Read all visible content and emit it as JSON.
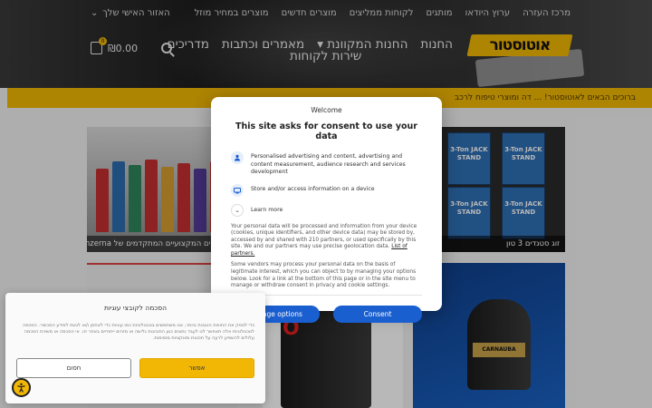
{
  "header": {
    "top_nav": [
      "מרכז העזרה",
      "ערוץ היודאו",
      "מותגים",
      "לקוחות ממליצים",
      "מוצרים חדשים",
      "מוצרים במחיר מוזל"
    ],
    "region_label": "האזור האישי שלך",
    "logo_text": "אוטוסטור",
    "main_nav": [
      "החנות",
      "החנות המקוונת",
      "מאמרים וכתבות",
      "מדריכים"
    ],
    "main_nav_second": "שירות לקוחות",
    "cart_total": "₪0.00",
    "cart_count": "0",
    "search_icon": "search-icon",
    "cart_icon": "shopping-bag-icon"
  },
  "announcement": "ברוכים הבאים לאוטוסטור! ... דה ומוצרי טיפוח לרכב",
  "products": [
    {
      "caption": "המוצרים המקצועיים המתקדמים של Menzerna גרמניה"
    },
    {
      "caption": "זוג סטנדים 3 טון"
    }
  ],
  "product_images": {
    "jack_text": "3-Ton JACK STAND",
    "can_text": "O",
    "wax_text": "CARNAUBA"
  },
  "consent": {
    "welcome": "Welcome",
    "title": "This site asks for consent to use your data",
    "purpose_1": "Personalised advertising and content, advertising and content measurement, audience research and services development",
    "purpose_2": "Store and/or access information on a device",
    "learn_more": "Learn more",
    "para_1": "Your personal data will be processed and information from your device (cookies, unique identifiers, and other device data) may be stored by, accessed by and shared with 210 partners, or used specifically by this site. We and our partners may use precise geolocation data.",
    "partners_link": "List of partners.",
    "para_2": "Some vendors may process your personal data on the basis of legitimate interest, which you can object to by managing your options below. Look for a link at the bottom of this page or in the site menu to manage or withdraw consent in privacy and cookie settings.",
    "manage_button": "Manage options",
    "consent_button": "Consent"
  },
  "cookie_panel": {
    "title": "הסכמה לקובצי עוגיות",
    "body": "כדי לספק את החוויות הטובות ביותר, אנו משתמשים בטכנולוגיות כמו עוגיות כדי לאחסן ו/או לגשת למידע המכשיר. הסכמה לטכנולוגיות אלה תאפשר לנו לעבד נתונים כגון התנהגות גלישה או מזהים ייחודיים באתר זה. אי הסכמה או משיכת הסכמה עלולים להשפיע לרעה על תכונות ופונקציות מסוימות.",
    "reject": "חסום",
    "accept": "אפשר"
  },
  "colors": {
    "brand_yellow": "#f2b705",
    "consent_blue": "#1a5fd0"
  }
}
